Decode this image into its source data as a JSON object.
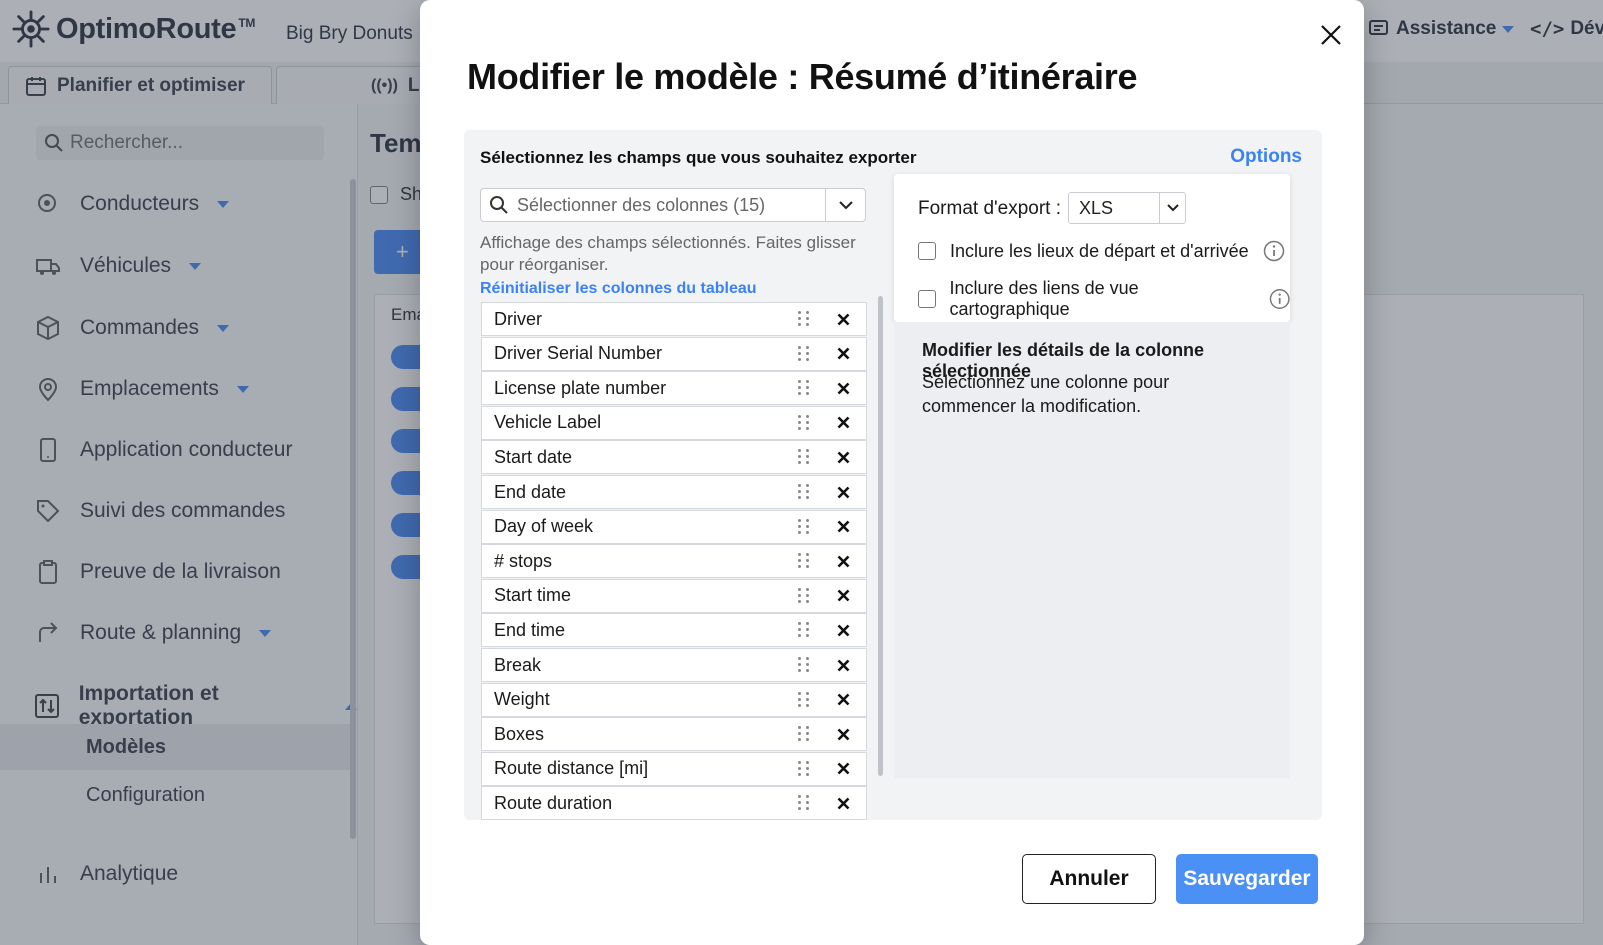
{
  "app": {
    "brand": "OptimoRoute",
    "trademark": "TM",
    "company": "Big Bry Donuts",
    "top_right": {
      "assistance": "Assistance",
      "dev": "Déve"
    },
    "tabs": [
      {
        "label": "Planifier et optimiser"
      },
      {
        "label": "L"
      }
    ],
    "search_placeholder": "Rechercher...",
    "sidebar": {
      "items": [
        {
          "label": "Conducteurs",
          "icon": "drivers-icon"
        },
        {
          "label": "Véhicules",
          "icon": "truck-icon"
        },
        {
          "label": "Commandes",
          "icon": "box-icon"
        },
        {
          "label": "Emplacements",
          "icon": "location-pin-icon"
        },
        {
          "label": "Application conducteur",
          "icon": "mobile-phone-icon"
        },
        {
          "label": "Suivi des commandes",
          "icon": "tag-icon"
        },
        {
          "label": "Preuve de la livraison",
          "icon": "clipboard-icon"
        },
        {
          "label": "Route & planning",
          "icon": "route-arrow-icon"
        },
        {
          "label": "Importation et exportation",
          "icon": "import-export-icon"
        }
      ],
      "sub_items": [
        {
          "label": "Modèles",
          "active": true
        },
        {
          "label": "Configuration",
          "active": false
        }
      ],
      "analytics": "Analytique"
    },
    "content": {
      "title": "Tem",
      "checkbox_label": "Sh",
      "add_button": "+",
      "table_header": "Ema"
    }
  },
  "modal": {
    "title": "Modifier le modèle : Résumé d’itinéraire",
    "fields_heading": "Sélectionnez les champs que vous souhaitez exporter",
    "options_link": "Options",
    "column_select_placeholder": "Sélectionner des colonnes (15)",
    "helper_text": "Affichage des champs sélectionnés. Faites glisser pour réorganiser.",
    "reset_link": "Réinitialiser les colonnes du tableau",
    "columns": [
      "Driver",
      "Driver Serial Number",
      "License plate number",
      "Vehicle Label",
      "Start date",
      "End date",
      "Day of week",
      "# stops",
      "Start time",
      "End time",
      "Break",
      "Weight",
      "Boxes",
      "Route distance [mi]",
      "Route duration"
    ],
    "export": {
      "label": "Format d'export :",
      "value": "XLS",
      "include_start_end": "Inclure les lieux de départ et d'arrivée",
      "include_map_links": "Inclure des liens de vue cartographique"
    },
    "details": {
      "title": "Modifier les détails de la colonne sélectionnée",
      "text": "Sélectionnez une colonne pour commencer la modification."
    },
    "cancel_button": "Annuler",
    "save_button": "Sauvegarder"
  },
  "colors": {
    "accent": "#3b82f6",
    "save_button": "#4a90f5",
    "overlay": "rgba(70,78,92,0.45)"
  }
}
